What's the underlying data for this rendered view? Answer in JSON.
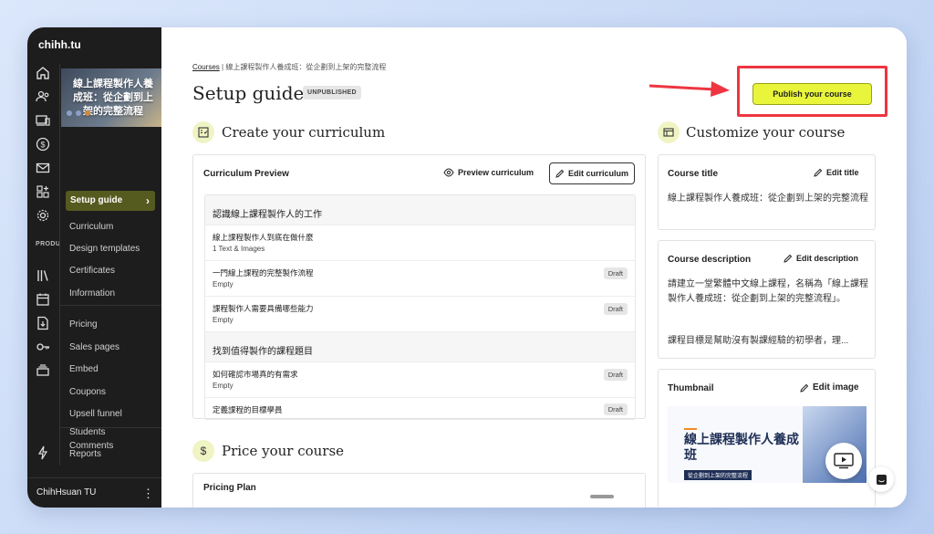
{
  "app": {
    "brand": "chihh.tu"
  },
  "sidebar": {
    "rail_label": "PRODU",
    "course_thumb_text": "線上課程製作人養成班：從企劃到上架的完整流程",
    "items": [
      {
        "label": "Setup guide",
        "active": true
      },
      {
        "label": "Curriculum"
      },
      {
        "label": "Design templates"
      },
      {
        "label": "Certificates"
      },
      {
        "label": "Information"
      },
      {
        "label": "Pricing"
      },
      {
        "label": "Sales pages"
      },
      {
        "label": "Embed"
      },
      {
        "label": "Coupons"
      },
      {
        "label": "Upsell funnel"
      },
      {
        "label": "Comments"
      },
      {
        "label": "Students"
      },
      {
        "label": "Reports"
      }
    ],
    "user": "ChihHsuan TU"
  },
  "breadcrumb": {
    "root": "Courses",
    "separator": "|",
    "current": "線上課程製作人養成班：從企劃到上架的完整流程"
  },
  "header": {
    "title": "Setup guide",
    "status": "UNPUBLISHED",
    "publish_label": "Publish your course"
  },
  "curriculum": {
    "section_title": "Create your curriculum",
    "card_title": "Curriculum Preview",
    "preview_label": "Preview curriculum",
    "edit_label": "Edit curriculum",
    "rows": [
      {
        "type": "chapter",
        "title": "認識線上課程製作人的工作"
      },
      {
        "type": "lesson",
        "title": "線上課程製作人到底在做什麼",
        "sub": "1 Text & Images",
        "badge": ""
      },
      {
        "type": "lesson",
        "title": "一門線上課程的完整製作流程",
        "sub": "Empty",
        "badge": "Draft"
      },
      {
        "type": "lesson",
        "title": "課程製作人需要具備哪些能力",
        "sub": "Empty",
        "badge": "Draft"
      },
      {
        "type": "chapter",
        "title": "找到值得製作的課程題目"
      },
      {
        "type": "lesson",
        "title": "如何確認市場真的有需求",
        "sub": "Empty",
        "badge": "Draft"
      },
      {
        "type": "lesson",
        "title": "定義課程的目標學員",
        "sub": "",
        "badge": "Draft"
      }
    ]
  },
  "pricing": {
    "section_title": "Price your course",
    "card_title": "Pricing Plan"
  },
  "customize": {
    "section_title": "Customize your course",
    "title_card": {
      "label": "Course title",
      "edit": "Edit title",
      "value": "線上課程製作人養成班：從企劃到上架的完整流程"
    },
    "description_card": {
      "label": "Course description",
      "edit": "Edit description",
      "value_p1": "請建立一堂繁體中文線上課程，名稱為「線上課程製作人養成班：從企劃到上架的完整流程」。",
      "value_p2": "課程目標是幫助沒有製課經驗的初學者，理..."
    },
    "thumbnail_card": {
      "label": "Thumbnail",
      "edit": "Edit image",
      "image_title": "線上課程製作人養成班",
      "image_subtitle": "從企劃到上架的完整流程"
    }
  },
  "colors": {
    "accent": "#e9f53a",
    "annotation": "#ee3540",
    "sidebar": "#1d1d1d"
  }
}
